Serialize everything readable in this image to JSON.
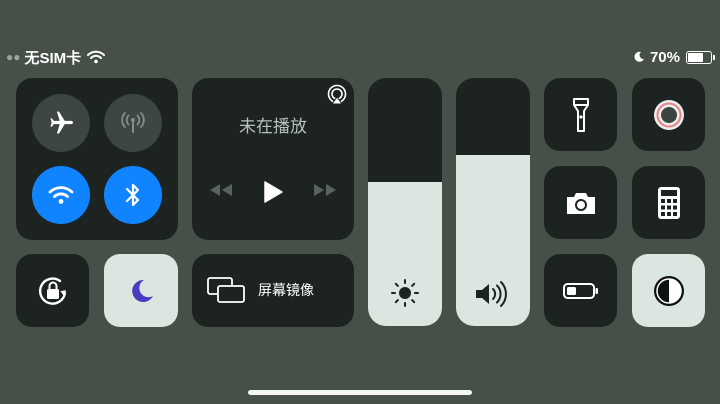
{
  "status_bar": {
    "carrier": "无SIM卡",
    "battery_percent": "70%",
    "battery_level": 0.7,
    "icons": [
      "wifi-icon",
      "moon-icon",
      "battery-icon"
    ]
  },
  "connectivity": {
    "airplane_mode": {
      "icon": "airplane-icon",
      "active": false
    },
    "cellular_data": {
      "icon": "antenna-icon",
      "active": false
    },
    "wifi": {
      "icon": "wifi-icon",
      "active": true
    },
    "bluetooth": {
      "icon": "bluetooth-icon",
      "active": true
    }
  },
  "media": {
    "status": "未在播放",
    "icons": [
      "airplay-icon",
      "rewind-icon",
      "play-icon",
      "fast-forward-icon"
    ]
  },
  "screen_mirroring": {
    "label": "屏幕镜像"
  },
  "sliders": {
    "brightness": {
      "level": 0.58,
      "icon": "sun-icon"
    },
    "volume": {
      "level": 0.69,
      "icon": "speaker-icon"
    }
  },
  "colors": {
    "background": "#465049",
    "tile": "#1d2320",
    "tile_active": "#dbe6e1",
    "blue_active": "#0f84fe"
  }
}
